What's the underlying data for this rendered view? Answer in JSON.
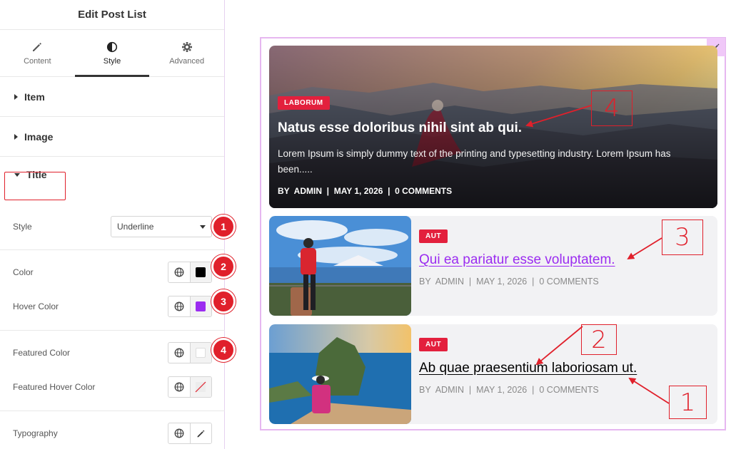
{
  "panel": {
    "title": "Edit Post List",
    "tabs": [
      {
        "label": "Content",
        "icon": "pencil-icon"
      },
      {
        "label": "Style",
        "icon": "contrast-icon"
      },
      {
        "label": "Advanced",
        "icon": "gear-icon"
      }
    ],
    "sections": {
      "item": "Item",
      "image": "Image",
      "title": "Title"
    },
    "controls": {
      "style_label": "Style",
      "style_value": "Underline",
      "color_label": "Color",
      "hover_color_label": "Hover Color",
      "featured_color_label": "Featured Color",
      "featured_hover_color_label": "Featured Hover Color",
      "typography_label": "Typography"
    },
    "markers": [
      "1",
      "2",
      "3",
      "4"
    ]
  },
  "colors": {
    "color": "#000000",
    "hover_color": "#9b2cf0",
    "featured_color": "#ffffff",
    "accent_red": "#e0202b",
    "category_red": "#e3203d"
  },
  "preview": {
    "featured": {
      "category": "LABORUM",
      "title": "Natus esse doloribus nihil sint ab qui.",
      "excerpt": "Lorem Ipsum is simply dummy text of the printing and typesetting industry. Lorem Ipsum has been.....",
      "meta": "BY  ADMIN  |  MAY 1, 2026  |  0 COMMENTS"
    },
    "posts": [
      {
        "category": "AUT",
        "title": "Qui ea pariatur esse voluptatem.",
        "meta": "BY  ADMIN  |  MAY 1, 2026  |  0 COMMENTS"
      },
      {
        "category": "AUT",
        "title": "Ab quae praesentium laboriosam ut.",
        "meta": "BY  ADMIN  |  MAY 1, 2026  |  0 COMMENTS"
      }
    ],
    "annotations": [
      "4",
      "3",
      "2",
      "1"
    ]
  }
}
